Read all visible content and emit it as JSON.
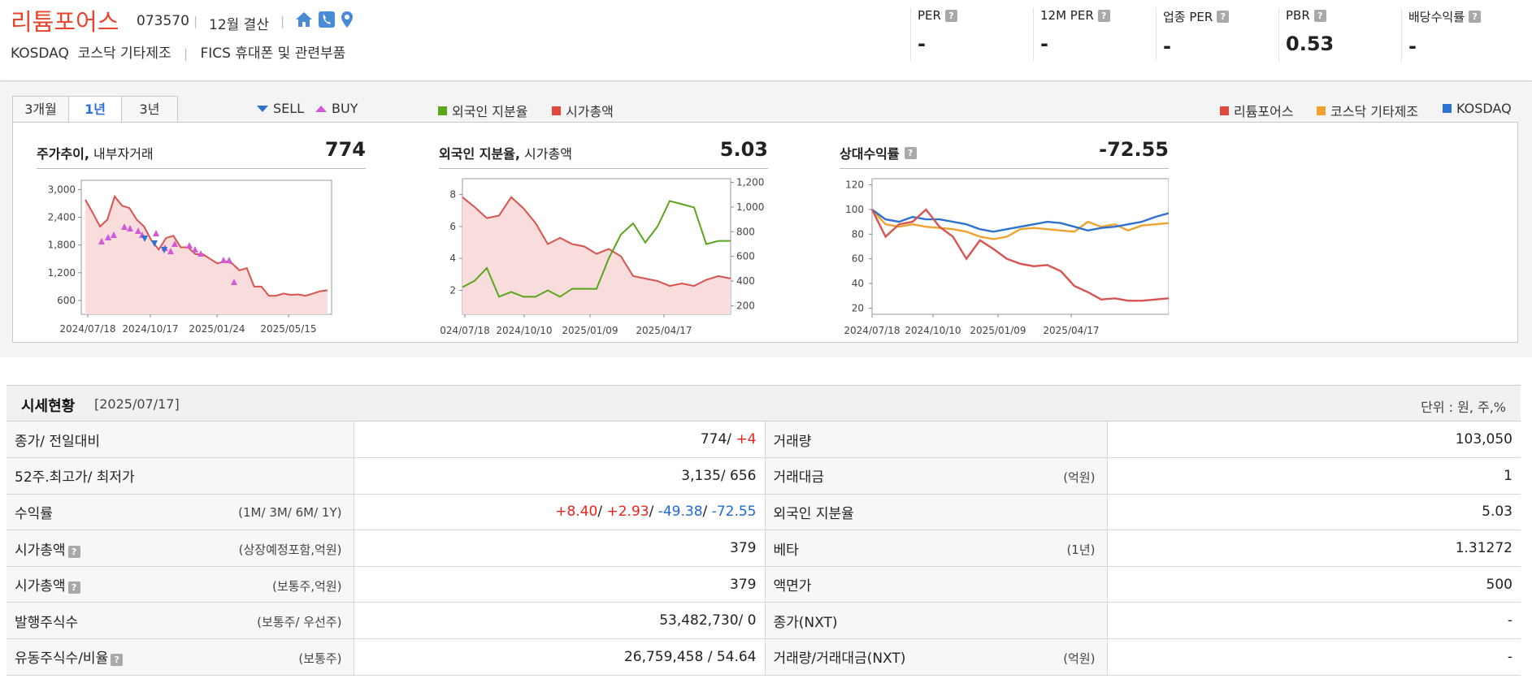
{
  "header": {
    "company_name": "리튬포어스",
    "stock_code": "073570",
    "settlement": "12월 결산",
    "market": "KOSDAQ",
    "market_category": "코스닥 기타제조",
    "fics": "FICS 휴대폰 및 관련부품",
    "icons": [
      "home-icon",
      "phone-icon",
      "map-pin-icon"
    ],
    "metrics": [
      {
        "label": "PER",
        "value": "-"
      },
      {
        "label": "12M PER",
        "value": "-"
      },
      {
        "label": "업종 PER",
        "value": "-"
      },
      {
        "label": "PBR",
        "value": "0.53"
      },
      {
        "label": "배당수익률",
        "value": "-"
      }
    ]
  },
  "tabs": [
    {
      "label": "3개월",
      "active": false
    },
    {
      "label": "1년",
      "active": true
    },
    {
      "label": "3년",
      "active": false
    }
  ],
  "legends": {
    "sell": "SELL",
    "buy": "BUY",
    "foreign_ratio": "외국인 지분율",
    "market_cap": "시가총액",
    "company": "리튬포어스",
    "sector": "코스닥 기타제조",
    "index": "KOSDAQ"
  },
  "colors": {
    "brand_red": "#e8452f",
    "price_line": "#d9534f",
    "foreign_line": "#5aa61b",
    "sector_line": "#f0a22e",
    "index_line": "#2e72d0",
    "sell_marker": "#2e72d0",
    "buy_marker": "#d35ad6",
    "up": "#e8251c",
    "down": "#1f6ad3"
  },
  "charts": [
    {
      "title_bold": "주가추이,",
      "title_rest": " 내부자거래",
      "value": "774",
      "y_ticks": [
        "3,000",
        "2,400",
        "1,800",
        "1,200",
        "600"
      ],
      "x_ticks": [
        "2024/07/18",
        "2024/10/17",
        "2025/01/24",
        "2025/05/15"
      ]
    },
    {
      "title_bold": "외국인 지분율,",
      "title_rest": " 시가총액",
      "value": "5.03",
      "y_ticks_left": [
        "8",
        "6",
        "4",
        "2"
      ],
      "y_ticks_right": [
        "1,200",
        "1,000",
        "800",
        "600",
        "400",
        "200"
      ],
      "x_ticks": [
        "024/07/18",
        "2024/10/10",
        "2025/01/09",
        "2025/04/17"
      ]
    },
    {
      "title_bold": "상대수익률",
      "title_rest": "",
      "value": "-72.55",
      "y_ticks": [
        "120",
        "100",
        "80",
        "60",
        "40",
        "20"
      ],
      "x_ticks": [
        "2024/07/18",
        "2024/10/10",
        "2025/01/09",
        "2025/04/17"
      ]
    }
  ],
  "chart_data": [
    {
      "type": "line",
      "title": "주가추이, 내부자거래",
      "x": [
        "2024/07/18",
        "2024/10/17",
        "2025/01/24",
        "2025/05/15"
      ],
      "ylim": [
        300,
        3200
      ],
      "series": [
        {
          "values": [
            2780,
            2500,
            2200,
            2350,
            2850,
            2650,
            2600,
            2350,
            2200,
            1900,
            1700,
            1950,
            2000,
            1750,
            1750,
            1600,
            1600,
            1500,
            1400,
            1450,
            1400,
            1250,
            1300,
            900,
            900,
            700,
            700,
            750,
            720,
            730,
            700,
            750,
            800,
            820
          ]
        }
      ],
      "buy_count": 17,
      "sell_count": 3
    },
    {
      "type": "line",
      "title": "외국인 지분율, 시가총액",
      "x": [
        "2024/07/18",
        "2024/10/10",
        "2025/01/09",
        "2025/04/17"
      ],
      "series": [
        {
          "name": "외국인 지분율",
          "axis": "left",
          "ylim": [
            0.5,
            9
          ],
          "values": [
            2.2,
            2.6,
            3.4,
            1.6,
            1.9,
            1.6,
            1.6,
            2.0,
            1.6,
            2.1,
            2.1,
            2.1,
            4.0,
            5.5,
            6.2,
            5.0,
            6.0,
            7.6,
            7.4,
            7.2,
            4.9,
            5.1,
            5.1
          ]
        },
        {
          "name": "시가총액",
          "axis": "right",
          "ylim": [
            130,
            1230
          ],
          "values": [
            1080,
            1000,
            910,
            930,
            1080,
            990,
            870,
            700,
            750,
            700,
            680,
            620,
            660,
            600,
            440,
            420,
            400,
            360,
            380,
            360,
            410,
            440,
            420
          ]
        }
      ]
    },
    {
      "type": "line",
      "title": "상대수익률",
      "x": [
        "2024/07/18",
        "2024/10/10",
        "2025/01/09",
        "2025/04/17"
      ],
      "ylim": [
        15,
        125
      ],
      "series": [
        {
          "name": "리튬포어스",
          "values": [
            100,
            78,
            88,
            90,
            100,
            86,
            78,
            60,
            75,
            68,
            60,
            56,
            54,
            55,
            50,
            38,
            33,
            27,
            28,
            26,
            26,
            27,
            28
          ]
        },
        {
          "name": "코스닥 기타제조",
          "values": [
            100,
            88,
            86,
            88,
            86,
            85,
            84,
            82,
            78,
            76,
            78,
            84,
            85,
            84,
            83,
            82,
            90,
            86,
            88,
            83,
            87,
            88,
            89
          ]
        },
        {
          "name": "KOSDAQ",
          "values": [
            100,
            92,
            90,
            94,
            92,
            92,
            90,
            88,
            84,
            82,
            84,
            86,
            88,
            90,
            89,
            86,
            83,
            85,
            86,
            88,
            90,
            94,
            97
          ]
        }
      ]
    }
  ],
  "table": {
    "title": "시세현황",
    "date": "[2025/07/17]",
    "unit": "단위 : 원, 주,%",
    "rows": [
      {
        "l1": "종가/ 전일대비",
        "s1": "",
        "v1a": "774/ ",
        "v1b": "+4",
        "l2": "거래량",
        "s2": "",
        "v2": "103,050"
      },
      {
        "l1": "52주.최고가/ 최저가",
        "s1": "",
        "v1a": "3,135/ 656",
        "v1b": "",
        "l2": "거래대금",
        "s2": "(억원)",
        "v2": "1"
      },
      {
        "l1": "수익률",
        "s1": "(1M/ 3M/ 6M/ 1Y)",
        "returns": [
          "+8.40",
          "+2.93",
          "-49.38",
          "-72.55"
        ],
        "l2": "외국인 지분율",
        "s2": "",
        "v2": "5.03"
      },
      {
        "l1": "시가총액",
        "s1": "(상장예정포함,억원)",
        "v1a": "379",
        "v1b": "",
        "l2": "베타",
        "s2": "(1년)",
        "v2": "1.31272",
        "help": true
      },
      {
        "l1": "시가총액",
        "s1": "(보통주,억원)",
        "v1a": "379",
        "v1b": "",
        "l2": "액면가",
        "s2": "",
        "v2": "500",
        "help": true
      },
      {
        "l1": "발행주식수",
        "s1": "(보통주/ 우선주)",
        "v1a": "53,482,730/ 0",
        "v1b": "",
        "l2": "종가(NXT)",
        "s2": "",
        "v2": "-"
      },
      {
        "l1": "유동주식수/비율",
        "s1": "(보통주)",
        "v1a": "26,759,458 / 54.64",
        "v1b": "",
        "l2": "거래량/거래대금(NXT)",
        "s2": "(억원)",
        "v2": "-",
        "help": true
      }
    ]
  }
}
